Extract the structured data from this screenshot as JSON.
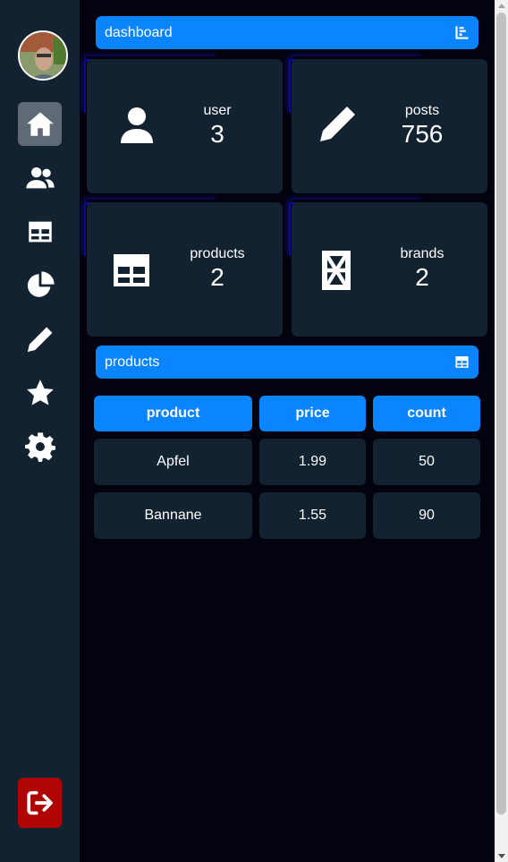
{
  "sidebar": {
    "avatar_alt": "user avatar",
    "items": [
      {
        "name": "home",
        "icon": "home-icon",
        "active": true
      },
      {
        "name": "users",
        "icon": "users-icon",
        "active": false
      },
      {
        "name": "table",
        "icon": "table-icon",
        "active": false
      },
      {
        "name": "chart",
        "icon": "pie-chart-icon",
        "active": false
      },
      {
        "name": "edit",
        "icon": "pencil-icon",
        "active": false
      },
      {
        "name": "favorites",
        "icon": "star-icon",
        "active": false
      },
      {
        "name": "settings",
        "icon": "gear-icon",
        "active": false
      }
    ],
    "logout_icon": "logout-icon"
  },
  "dashboard": {
    "title": "dashboard",
    "icon": "bar-chart-icon"
  },
  "stats": [
    {
      "label": "user",
      "value": "3",
      "icon": "user-icon"
    },
    {
      "label": "posts",
      "value": "756",
      "icon": "pencil-icon"
    },
    {
      "label": "products",
      "value": "2",
      "icon": "table-icon"
    },
    {
      "label": "brands",
      "value": "2",
      "icon": "brand-box-icon"
    }
  ],
  "products_section": {
    "title": "products",
    "icon": "table-icon"
  },
  "table": {
    "headers": [
      "product",
      "price",
      "count"
    ],
    "rows": [
      [
        "Apfel",
        "1.99",
        "50"
      ],
      [
        "Bannane",
        "1.55",
        "90"
      ]
    ]
  },
  "colors": {
    "accent": "#0a84ff",
    "sidebar": "#132231",
    "background": "#03030f",
    "logout": "#b10505"
  }
}
